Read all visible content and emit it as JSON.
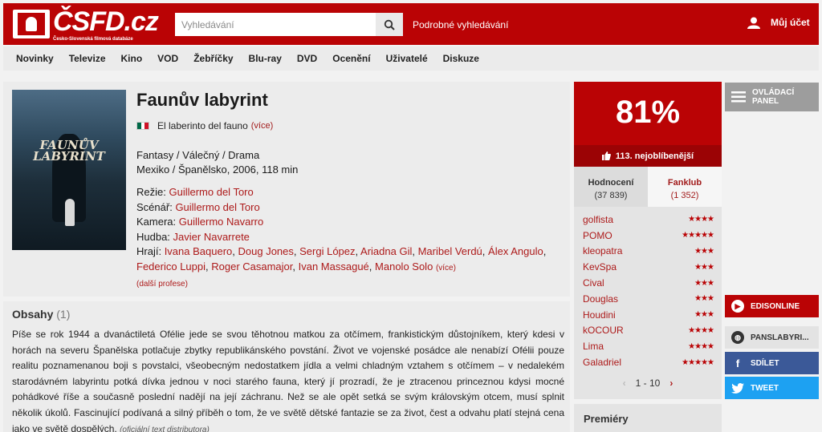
{
  "header": {
    "logo_text": "ČSFD.cz",
    "logo_subtitle": "Česko-Slovenská filmová databáze",
    "search_placeholder": "Vyhledávání",
    "advanced_search": "Podrobné vyhledávání",
    "account_label": "Můj účet"
  },
  "nav": {
    "items": [
      "Novinky",
      "Televize",
      "Kino",
      "VOD",
      "Žebříčky",
      "Blu-ray",
      "DVD",
      "Ocenění",
      "Uživatelé",
      "Diskuze"
    ]
  },
  "poster": {
    "title_line1": "FAUNŮV",
    "title_line2": "LABYRINT"
  },
  "film": {
    "title": "Faunův labyrint",
    "alt_title": "El laberinto del fauno",
    "alt_more": "(více)",
    "flag_colors": [
      "#006847",
      "#ffffff",
      "#ce1126"
    ],
    "genres": "Fantasy / Válečný / Drama",
    "origin": "Mexiko / Španělsko, 2006, 118 min",
    "director_label": "Režie:",
    "director": "Guillermo del Toro",
    "writer_label": "Scénář:",
    "writer": "Guillermo del Toro",
    "camera_label": "Kamera:",
    "camera": "Guillermo Navarro",
    "music_label": "Hudba:",
    "music": "Javier Navarrete",
    "cast_label": "Hrají:",
    "cast": [
      "Ivana Baquero",
      "Doug Jones",
      "Sergi López",
      "Ariadna Gil",
      "Maribel Verdú",
      "Álex Angulo",
      "Federico Luppi",
      "Roger Casamajor",
      "Ivan Massagué",
      "Manolo Solo"
    ],
    "cast_more": "(více)",
    "more_professions": "(další profese)"
  },
  "synopsis": {
    "heading": "Obsahy",
    "count": "(1)",
    "text": "Píše se rok 1944 a dvanáctiletá Ofélie jede se svou těhotnou matkou za otčímem, frankistickým důstojníkem, který kdesi v horách na severu Španělska potlačuje zbytky republikánského povstání. Život ve vojenské posádce ale nenabízí Ofélii pouze realitu poznamenanou boji s povstalci, všeobecným nedostatkem jídla a velmi chladným vztahem s otčímem – v nedalekém starodávném labyrintu potká dívka jednou v noci starého fauna, který jí prozradí, že je ztracenou princeznou kdysi mocné pohádkové říše a současně poslední nadějí na její záchranu. Než se ale opět setká se svým královským otcem, musí splnit několik úkolů. Fascinující podívaná a silný příběh o tom, že ve světě dětské fantazie se za život, čest a odvahu platí stejná cena jako ve světě dospělých.",
    "source": "(oficiální text distributora)"
  },
  "rating": {
    "value": "81%",
    "favorite_rank": "113. nejoblíbenější",
    "tab_ratings": "Hodnocení",
    "tab_ratings_count": "(37 839)",
    "tab_fanclub": "Fanklub",
    "tab_fanclub_count": "(1 352)",
    "user_ratings": [
      {
        "user": "golfista",
        "stars": "★★★★"
      },
      {
        "user": "POMO",
        "stars": "★★★★★"
      },
      {
        "user": "kleopatra",
        "stars": "★★★"
      },
      {
        "user": "KevSpa",
        "stars": "★★★"
      },
      {
        "user": "Cival",
        "stars": "★★★"
      },
      {
        "user": "Douglas",
        "stars": "★★★"
      },
      {
        "user": "Houdini",
        "stars": "★★★"
      },
      {
        "user": "kOCOUR",
        "stars": "★★★★"
      },
      {
        "user": "Lima",
        "stars": "★★★★"
      },
      {
        "user": "Galadriel",
        "stars": "★★★★★"
      }
    ],
    "pager": "1 - 10",
    "premieres": "Premiéry"
  },
  "sidebar": {
    "control_panel_line1": "OVLÁDACÍ",
    "control_panel_line2": "PANEL",
    "edisonline": "EDISONLINE",
    "panslabyrinth": "PANSLABYRI...",
    "share": "SDÍLET",
    "tweet": "TWEET"
  },
  "colors": {
    "brand_red": "#ba0305",
    "link_red": "#ad1a1a",
    "facebook": "#3b5998",
    "twitter": "#1da1f2"
  }
}
